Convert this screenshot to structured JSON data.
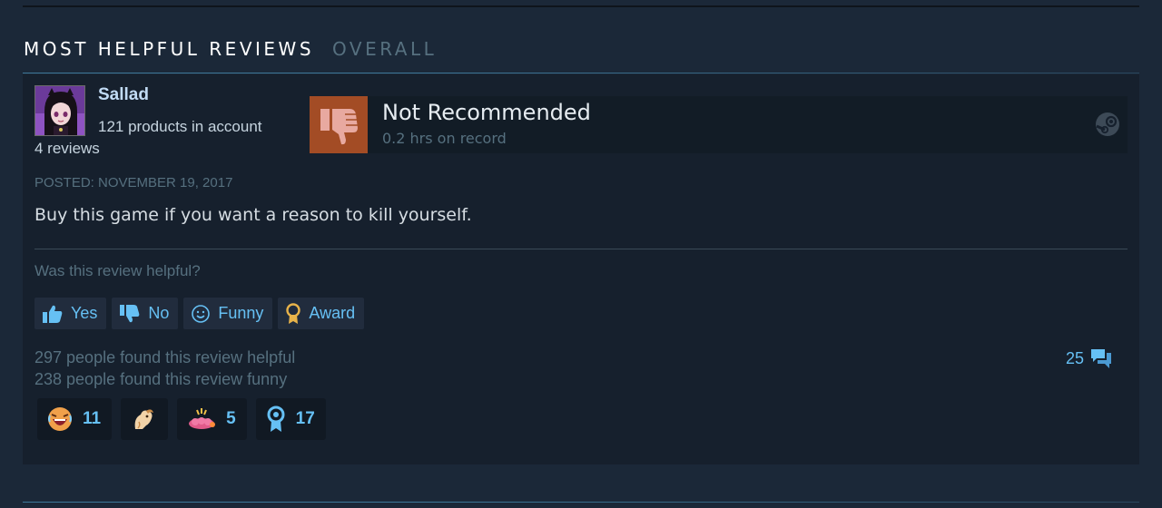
{
  "section": {
    "title": "MOST HELPFUL REVIEWS",
    "subtitle": "OVERALL"
  },
  "review": {
    "author": {
      "name": "Sallad",
      "products": "121 products in account",
      "reviews": "4 reviews"
    },
    "verdict": "Not Recommended",
    "hours": "0.2 hrs on record",
    "posted": "POSTED: NOVEMBER 19, 2017",
    "content": "Buy this game if you want a reason to kill yourself.",
    "helpful_question": "Was this review helpful?",
    "buttons": {
      "yes": "Yes",
      "no": "No",
      "funny": "Funny",
      "award": "Award"
    },
    "stats": {
      "helpful": "297 people found this review helpful",
      "funny": "238 people found this review funny"
    },
    "comments_count": "25",
    "awards": [
      {
        "icon": "laughing-face-icon",
        "count": "11"
      },
      {
        "icon": "goat-icon",
        "count": ""
      },
      {
        "icon": "mind-blown-icon",
        "count": "5"
      },
      {
        "icon": "medal-icon",
        "count": "17"
      }
    ]
  },
  "colors": {
    "background": "#1b2838",
    "panel": "#16202d",
    "not_recommended": "#a34c25",
    "link_blue": "#66c0f4",
    "muted": "#56707f",
    "award_gold": "#e8b34a"
  }
}
